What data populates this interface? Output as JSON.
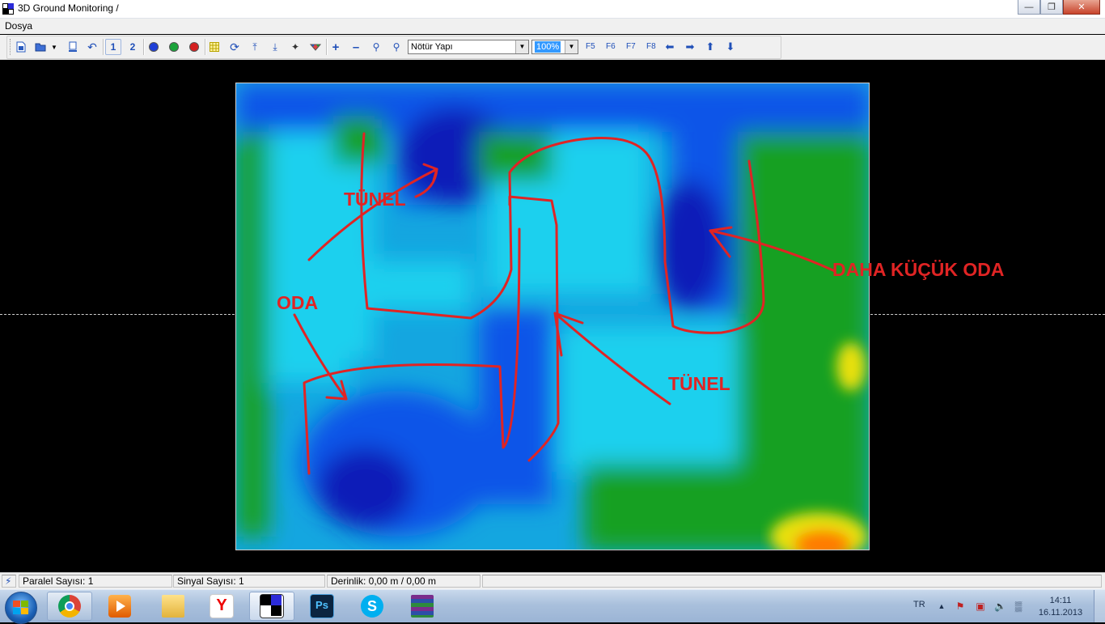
{
  "window": {
    "title": "3D Ground Monitoring  /",
    "minimize_icon": "minimize-icon",
    "maximize_icon": "restore-icon",
    "close_icon": "close-icon"
  },
  "menu": {
    "items": [
      "Dosya"
    ]
  },
  "toolbar": {
    "buttons": [
      {
        "name": "new-document-icon"
      },
      {
        "name": "open-folder-icon"
      },
      {
        "name": "dropdown-arrow-icon"
      },
      {
        "name": "device-icon"
      },
      {
        "name": "undo-icon"
      },
      {
        "name": "view-1-button",
        "label": "1"
      },
      {
        "name": "view-2-button",
        "label": "2"
      },
      {
        "name": "blue-marker-icon",
        "color": "#1f3fd6"
      },
      {
        "name": "green-marker-icon",
        "color": "#1aa33a"
      },
      {
        "name": "red-marker-icon",
        "color": "#d42020"
      },
      {
        "name": "grid-icon"
      },
      {
        "name": "refresh-icon"
      },
      {
        "name": "align-top-icon"
      },
      {
        "name": "align-bottom-icon"
      },
      {
        "name": "wand-icon"
      },
      {
        "name": "palette-icon"
      },
      {
        "name": "plus-icon"
      },
      {
        "name": "minus-icon"
      },
      {
        "name": "zoom-in-icon"
      },
      {
        "name": "zoom-out-icon"
      }
    ],
    "structure_select": "Nötür Yapı",
    "zoom_select": "100%",
    "fkeys": [
      "F5",
      "F6",
      "F7",
      "F8"
    ],
    "nav_icons": [
      "arrow-left-icon",
      "arrow-right-icon",
      "arrow-up-icon",
      "arrow-down-icon"
    ]
  },
  "scan": {
    "annotations": {
      "tunel_top": "TÜNEL",
      "oda": "ODA",
      "daha_kucuk_oda": "DAHA KÜÇÜK ODA",
      "tunel_bottom": "TÜNEL"
    },
    "colors": {
      "deep": "#0a1ab8",
      "blue": "#0b54e8",
      "mid": "#14a6e0",
      "cyan": "#1fd0ee",
      "green": "#18a020",
      "yellow": "#e8e010",
      "orange": "#ff7a00",
      "annotation": "#e02424"
    }
  },
  "status": {
    "paralel": "Paralel Sayısı: 1",
    "sinyal": "Sinyal Sayısı: 1",
    "derinlik": "Derinlik: 0,00 m / 0,00 m"
  },
  "taskbar": {
    "apps": [
      {
        "name": "chrome-icon"
      },
      {
        "name": "media-player-icon"
      },
      {
        "name": "explorer-folder-icon"
      },
      {
        "name": "yandex-icon"
      },
      {
        "name": "ground-monitoring-icon"
      },
      {
        "name": "photoshop-icon",
        "label": "Ps"
      },
      {
        "name": "skype-icon"
      },
      {
        "name": "winrar-icon"
      }
    ],
    "language": "TR",
    "time": "14:11",
    "date": "16.11.2013"
  }
}
